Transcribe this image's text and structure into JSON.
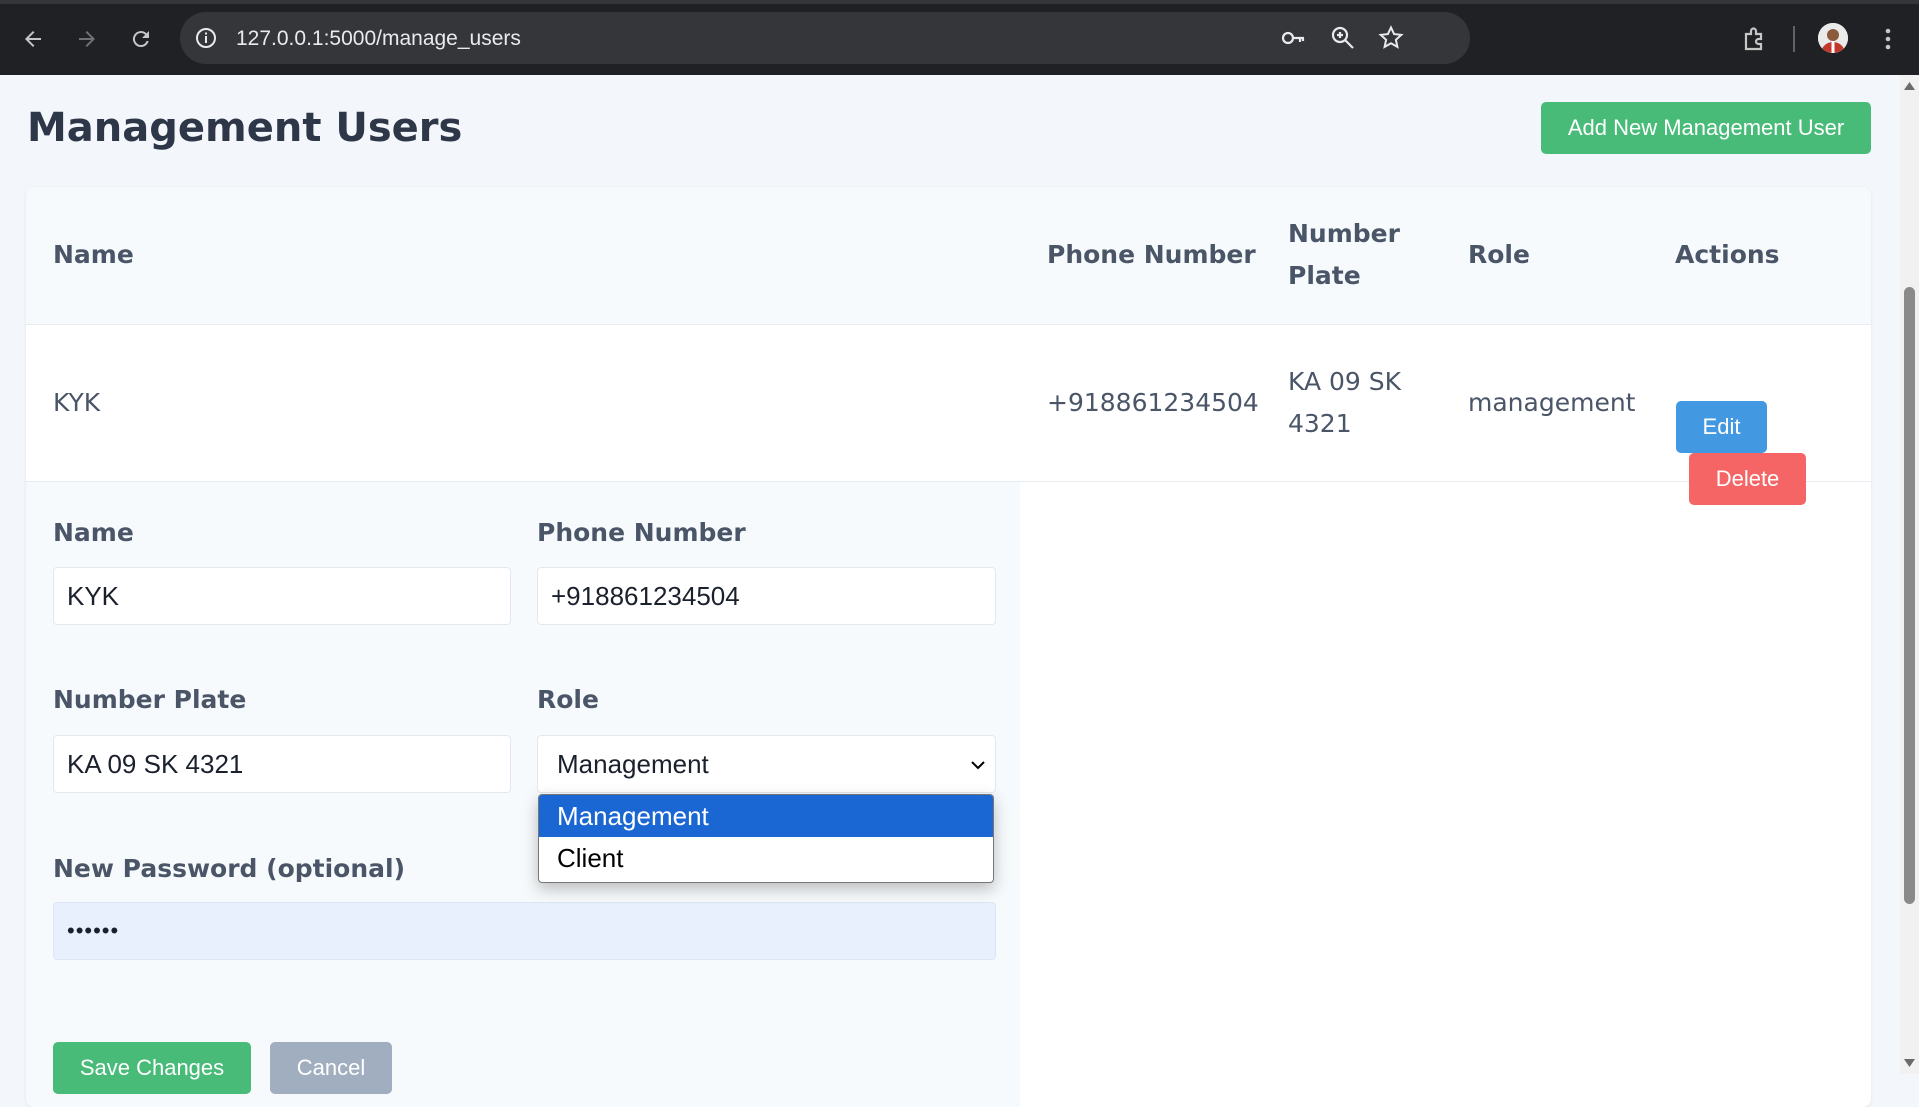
{
  "browser": {
    "url": "127.0.0.1:5000/manage_users"
  },
  "page": {
    "title": "Management Users",
    "add_button": "Add New Management User"
  },
  "table": {
    "headers": {
      "name": "Name",
      "phone": "Phone Number",
      "plate_line1": "Number",
      "plate_line2": "Plate",
      "role": "Role",
      "actions": "Actions"
    },
    "rows": [
      {
        "name": "KYK",
        "phone": "+918861234504",
        "plate_line1": "KA 09 SK",
        "plate_line2": "4321",
        "role": "management",
        "edit_label": "Edit",
        "delete_label": "Delete"
      }
    ]
  },
  "edit_form": {
    "name_label": "Name",
    "name_value": "KYK",
    "phone_label": "Phone Number",
    "phone_value": "+918861234504",
    "plate_label": "Number Plate",
    "plate_value": "KA 09 SK 4321",
    "role_label": "Role",
    "role_value": "Management",
    "role_options": [
      "Management",
      "Client"
    ],
    "password_label": "New Password (optional)",
    "password_value": "••••••",
    "save_label": "Save Changes",
    "cancel_label": "Cancel"
  },
  "colors": {
    "primary_green": "#48bb78",
    "edit_blue": "#4299e1",
    "delete_red": "#f56565",
    "cancel_gray": "#a0aec0",
    "option_highlight": "#1a66d2"
  },
  "icons": [
    "back-icon",
    "forward-icon",
    "reload-icon",
    "site-info-icon",
    "password-key-icon",
    "zoom-icon",
    "bookmark-star-icon",
    "extensions-icon",
    "profile-avatar",
    "menu-dots-icon",
    "chevron-down-icon"
  ]
}
